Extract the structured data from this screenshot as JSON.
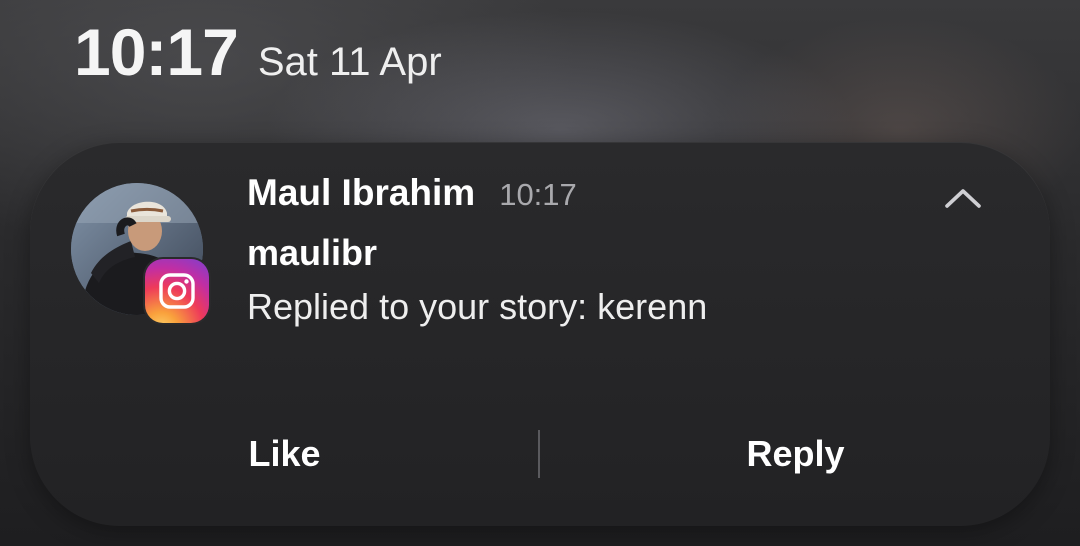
{
  "status_bar": {
    "time": "10:17",
    "date": "Sat 11 Apr"
  },
  "notification": {
    "app_icon": "instagram-icon",
    "sender": "Maul Ibrahim",
    "time": "10:17",
    "username": "maulibr",
    "message": "Replied to your story: kerenn",
    "collapse_icon": "chevron-up-icon",
    "actions": {
      "like_label": "Like",
      "reply_label": "Reply"
    }
  },
  "colors": {
    "card_background": "#262628",
    "secondary_text": "#a9a9ad",
    "divider": "#5a5a5e"
  }
}
